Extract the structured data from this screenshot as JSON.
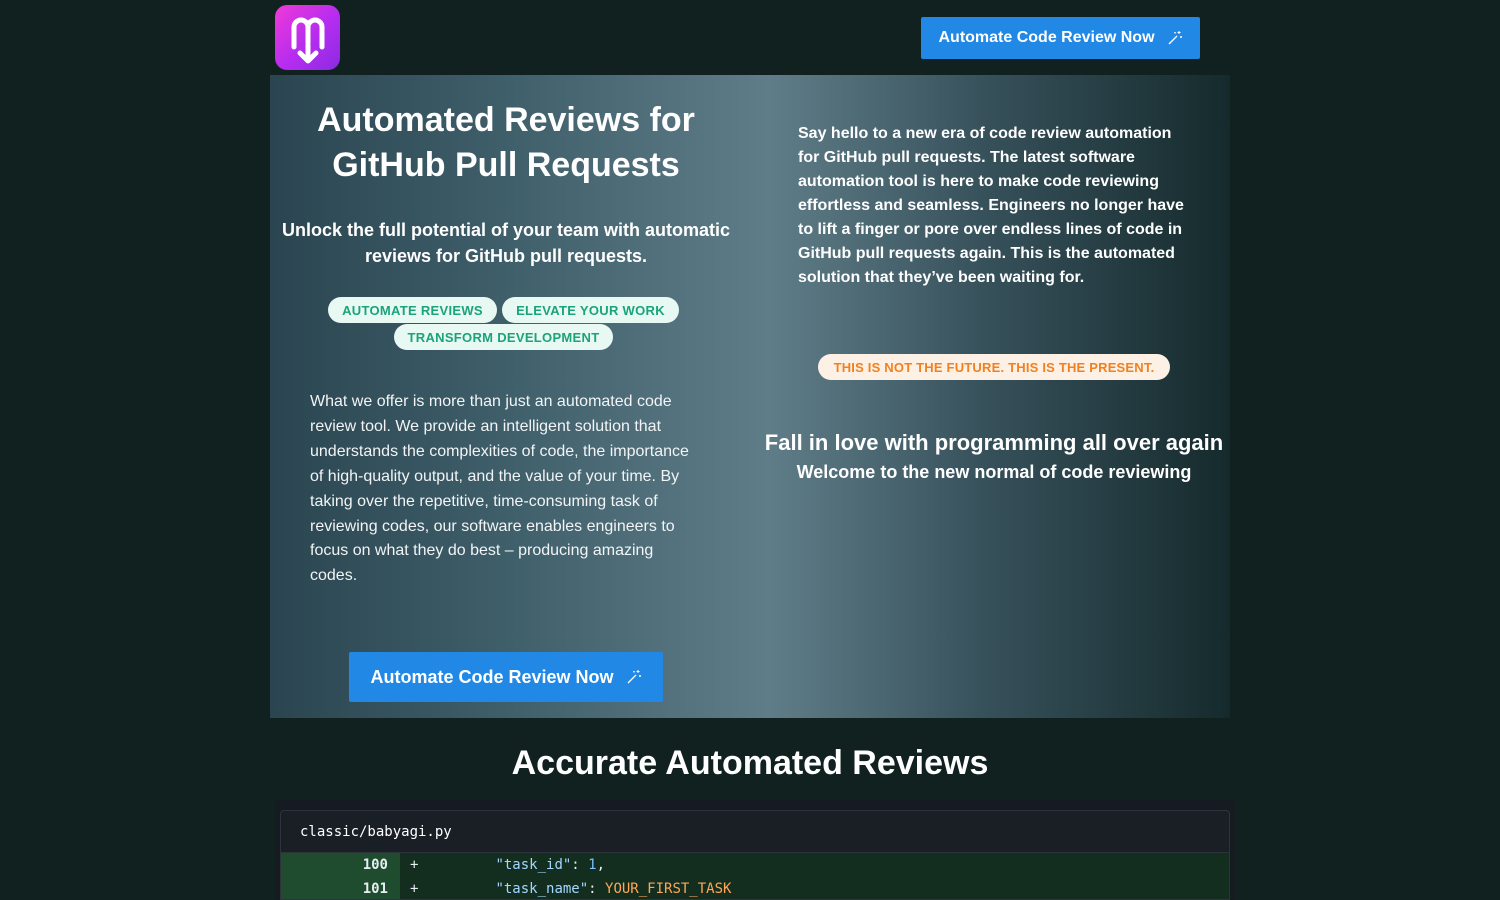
{
  "header": {
    "logo_icon": "logo-icon",
    "cta_label": "Automate Code Review Now"
  },
  "hero": {
    "title": "Automated Reviews for GitHub Pull Requests",
    "subtitle": "Unlock the full potential of your team with automatic reviews for GitHub pull requests.",
    "pills": [
      "AUTOMATE REVIEWS",
      "ELEVATE YOUR WORK",
      "TRANSFORM DEVELOPMENT"
    ],
    "offer_text": "What we offer is more than just an automated code review tool. We provide an intelligent solution that understands the complexities of code, the importance of high-quality output, and the value of your time. By taking over the repetitive, time-consuming task of reviewing codes, our software enables engineers to focus on what they do best – producing amazing codes.",
    "cta_label": "Automate Code Review Now",
    "intro_text": "Say hello to a new era of code review automation for GitHub pull requests. The latest software automation tool is here to make code reviewing effortless and seamless. Engineers no longer have to lift a finger or pore over endless lines of code in GitHub pull requests again. This is the automated solution that they’ve been waiting for.",
    "present_badge": "THIS IS NOT THE FUTURE. THIS IS THE PRESENT.",
    "love_heading": "Fall in love with programming all over again",
    "welcome_text": "Welcome to the new normal of code reviewing"
  },
  "reviews_section": {
    "title": "Accurate Automated Reviews",
    "file_name": "classic/babyagi.py",
    "lines": [
      {
        "number": "100",
        "sign": "+",
        "key": "\"task_id\"",
        "sep": ": ",
        "value": "1",
        "tail": ","
      },
      {
        "number": "101",
        "sign": "+",
        "key": "\"task_name\"",
        "sep": ": ",
        "value": "YOUR_FIRST_TASK",
        "tail": ""
      }
    ]
  },
  "colors": {
    "page_bg": "#102120",
    "button_bg": "#2188e6",
    "pill_green_text": "#1ba37a",
    "pill_orange_text": "#f2801f",
    "diff_added_bg": "#132e1e"
  }
}
